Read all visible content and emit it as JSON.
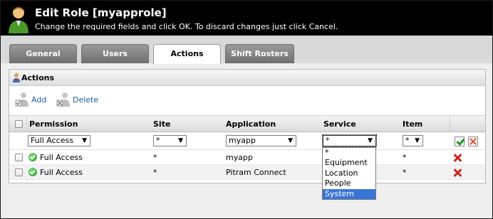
{
  "header": {
    "title": "Edit Role [myapprole]",
    "subtitle": "Change the required fields and click OK. To discard changes just click Cancel."
  },
  "tabs": [
    {
      "label": "General",
      "active": false
    },
    {
      "label": "Users",
      "active": false
    },
    {
      "label": "Actions",
      "active": true
    },
    {
      "label": "Shift Rosters",
      "active": false
    }
  ],
  "panel": {
    "title": "Actions",
    "toolbar": {
      "add_label": "Add",
      "delete_label": "Delete"
    }
  },
  "grid": {
    "columns": [
      "Permission",
      "Site",
      "Application",
      "Service",
      "Item"
    ],
    "edit_row": {
      "permission": "Full Access",
      "site": "*",
      "application": "myapp",
      "service": "*",
      "item": "*"
    },
    "rows": [
      {
        "permission": "Full Access",
        "site": "*",
        "application": "myapp",
        "service": "",
        "item": "*"
      },
      {
        "permission": "Full Access",
        "site": "*",
        "application": "Pitram Connect",
        "service": "",
        "item": "*"
      }
    ]
  },
  "service_dropdown": {
    "options": [
      "*",
      "Equipment",
      "Location",
      "People",
      "System"
    ],
    "highlighted": "System"
  },
  "icons": {
    "header": "user-icon",
    "panel": "actions-user-icon",
    "add": "add-item-icon",
    "delete": "delete-item-icon",
    "status": "ok-icon",
    "row_delete": "delete-icon",
    "save": "save-icon",
    "cancel": "cancel-icon"
  },
  "colors": {
    "header_bg": "#000000",
    "link": "#1a5fa8",
    "delete": "#d2231b",
    "ok": "#1b9b1b",
    "selection": "#3875d7"
  }
}
